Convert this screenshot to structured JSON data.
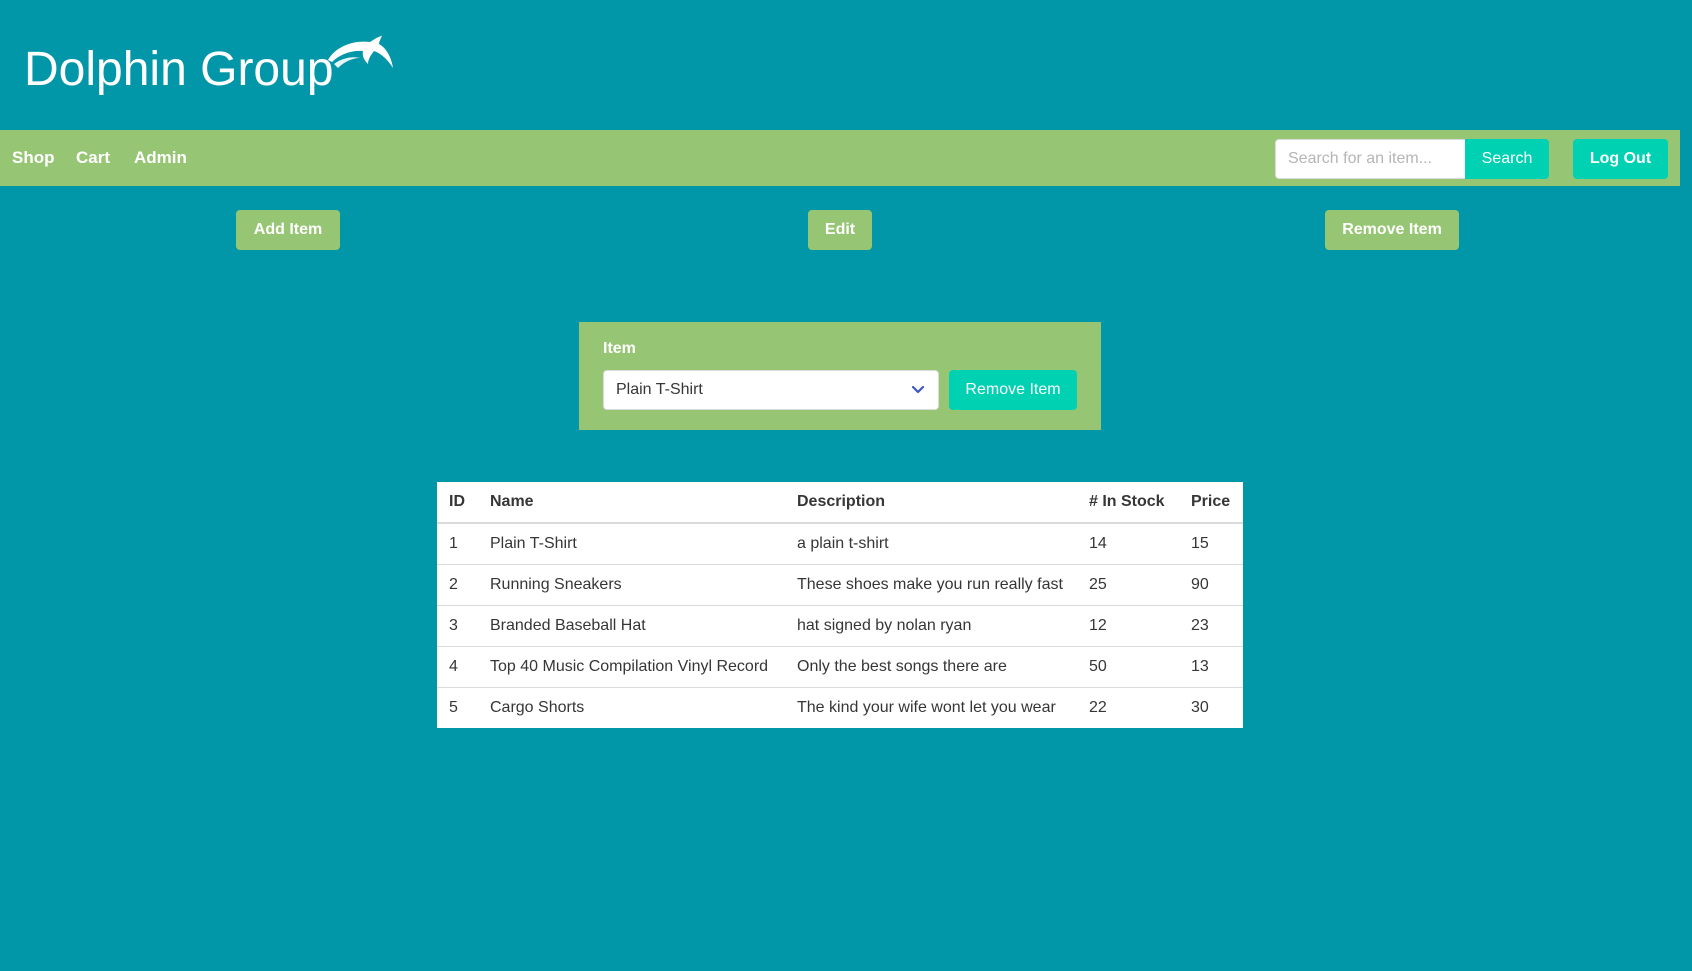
{
  "header": {
    "title": "Dolphin Group",
    "logo_icon": "dolphin-icon"
  },
  "nav": {
    "links": [
      "Shop",
      "Cart",
      "Admin"
    ],
    "search_placeholder": "Search for an item...",
    "search_value": "",
    "search_label": "Search",
    "logout_label": "Log Out"
  },
  "actions": {
    "add_label": "Add Item",
    "edit_label": "Edit",
    "remove_label": "Remove Item"
  },
  "remove_form": {
    "field_label": "Item",
    "selected_item": "Plain T-Shirt",
    "submit_label": "Remove Item"
  },
  "table": {
    "headers": [
      "ID",
      "Name",
      "Description",
      "# In Stock",
      "Price"
    ],
    "rows": [
      [
        "1",
        "Plain T-Shirt",
        "a plain t-shirt",
        "14",
        "15"
      ],
      [
        "2",
        "Running Sneakers",
        "These shoes make you run really fast",
        "25",
        "90"
      ],
      [
        "3",
        "Branded Baseball Hat",
        "hat signed by nolan ryan",
        "12",
        "23"
      ],
      [
        "4",
        "Top 40 Music Compilation Vinyl Record",
        "Only the best songs there are",
        "50",
        "13"
      ],
      [
        "5",
        "Cargo Shorts",
        "The kind your wife wont let you wear",
        "22",
        "30"
      ]
    ]
  },
  "colors": {
    "background": "#0197a8",
    "accent_green": "#96c673",
    "primary_teal": "#00d1b2"
  }
}
